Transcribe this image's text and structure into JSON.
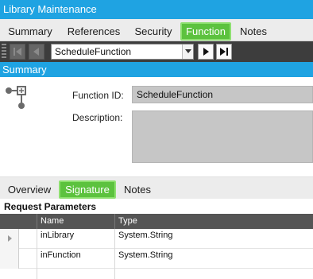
{
  "window": {
    "title": "Library Maintenance"
  },
  "top_tabs": [
    "Summary",
    "References",
    "Security",
    "Function",
    "Notes"
  ],
  "navigator": {
    "selected_function": "ScheduleFunction"
  },
  "summary_section": {
    "title": "Summary",
    "function_id_label": "Function ID:",
    "function_id_value": "ScheduleFunction",
    "description_label": "Description:",
    "description_value": ""
  },
  "sub_tabs": [
    "Overview",
    "Signature",
    "Notes"
  ],
  "request_parameters": {
    "title": "Request Parameters",
    "columns": [
      "Name",
      "Type"
    ],
    "rows": [
      {
        "name": "inLibrary",
        "type": "System.String"
      },
      {
        "name": "inFunction",
        "type": "System.String"
      }
    ]
  },
  "colors": {
    "accent_blue": "#1fa3e2",
    "active_tab_green": "#5cc23e",
    "toolbar_dark": "#3d3d3d"
  }
}
